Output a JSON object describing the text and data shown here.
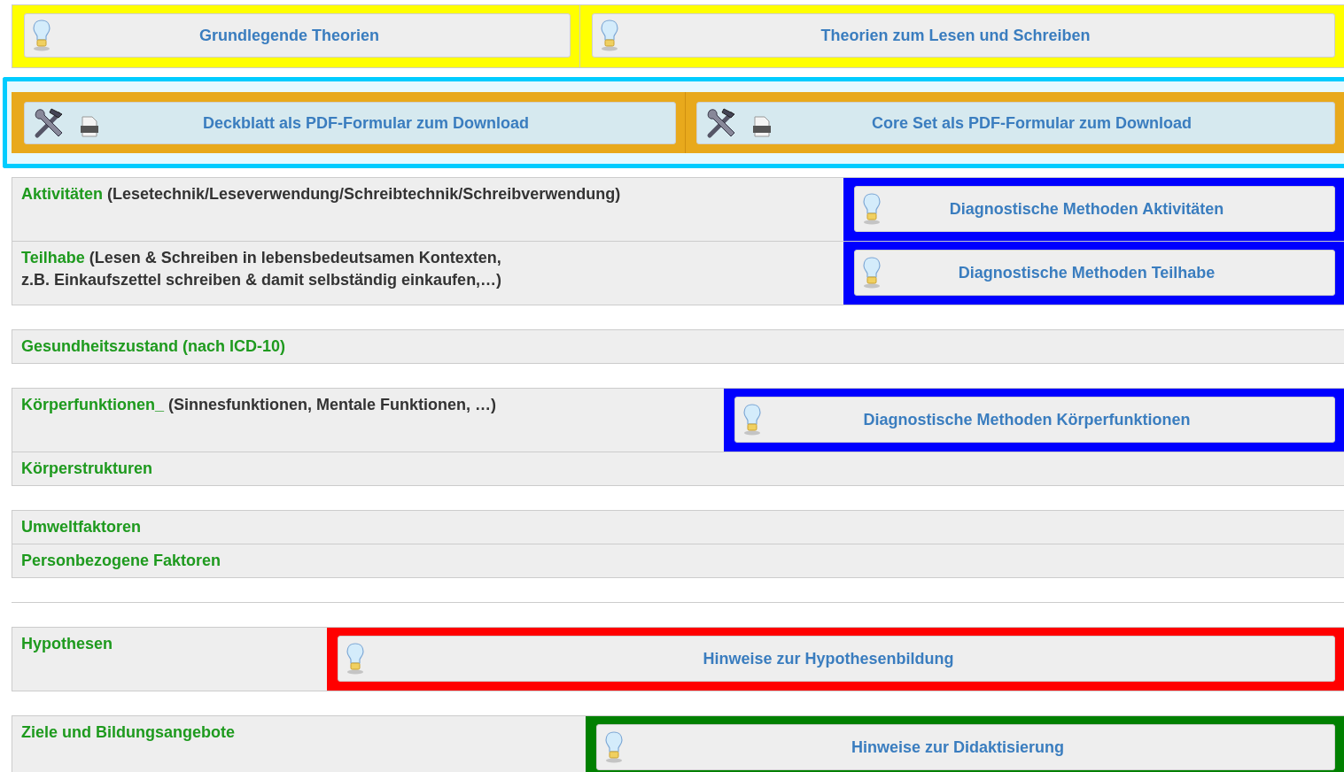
{
  "theory_buttons": [
    {
      "label": "Grundlegende Theorien"
    },
    {
      "label": "Theorien zum Lesen und Schreiben"
    }
  ],
  "download_buttons": [
    {
      "label": "Deckblatt als PDF-Formular zum Download"
    },
    {
      "label": "Core Set als PDF-Formular zum Download"
    }
  ],
  "sections": [
    {
      "rows": [
        {
          "title": "Aktivitäten",
          "detail": "(Lesetechnik/Leseverwendung/Schreibtechnik/Schreibverwendung)",
          "button": {
            "label": "Diagnostische Methoden Aktivitäten",
            "color": "#0000ff"
          }
        },
        {
          "title": "Teilhabe",
          "detail": "(Lesen & Schreiben in lebensbedeutsamen Kontexten,\nz.B. Einkaufszettel schreiben & damit selbständig einkaufen,…)",
          "button": {
            "label": "Diagnostische Methoden Teilhabe",
            "color": "#0000ff"
          }
        }
      ]
    },
    {
      "rows": [
        {
          "title": "Gesundheitszustand (nach ICD-10)"
        }
      ]
    },
    {
      "rows": [
        {
          "title": "Körperfunktionen_",
          "detail": "(Sinnesfunktionen, Mentale Funktionen, …)",
          "button": {
            "label": "Diagnostische Methoden Körperfunktionen",
            "color": "#0000ff"
          }
        },
        {
          "title": "Körperstrukturen"
        }
      ]
    },
    {
      "rows": [
        {
          "title": "Umweltfaktoren"
        },
        {
          "title": "Personbezogene Faktoren"
        }
      ]
    },
    {
      "rows": [
        {
          "title": "Hypothesen",
          "button": {
            "label": "Hinweise zur Hypothesenbildung",
            "color": "#ff0000"
          }
        }
      ]
    },
    {
      "rows": [
        {
          "title": "Ziele und Bildungsangebote",
          "button": {
            "label": "Hinweise zur Didaktisierung",
            "color": "#008000"
          }
        }
      ]
    }
  ]
}
